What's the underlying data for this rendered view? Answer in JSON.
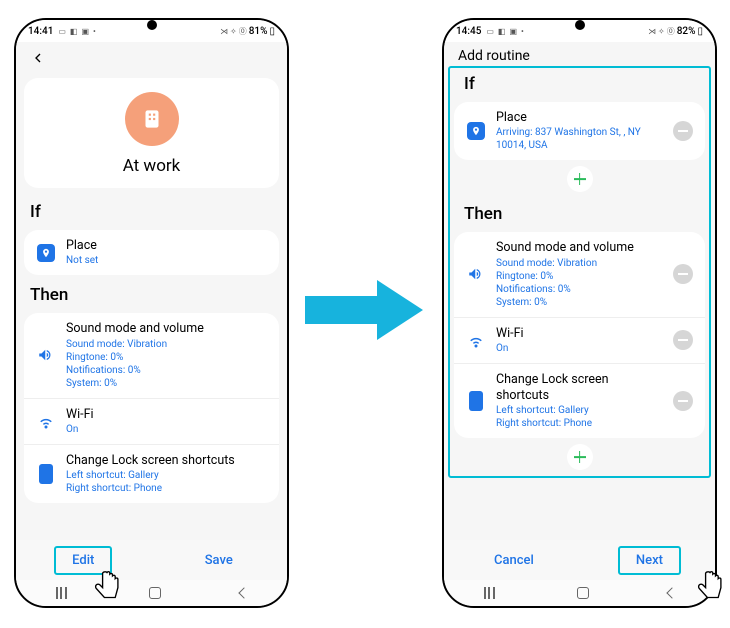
{
  "left": {
    "status": {
      "time": "14:41",
      "battery": "81%"
    },
    "title": "At work",
    "if_label": "If",
    "then_label": "Then",
    "place": {
      "title": "Place",
      "sub": "Not set"
    },
    "sound": {
      "title": "Sound mode and volume",
      "l1": "Sound mode: Vibration",
      "l2": "Ringtone: 0%",
      "l3": "Notifications: 0%",
      "l4": "System: 0%"
    },
    "wifi": {
      "title": "Wi-Fi",
      "sub": "On"
    },
    "lock": {
      "title": "Change Lock screen shortcuts",
      "l1": "Left shortcut: Gallery",
      "l2": "Right shortcut: Phone"
    },
    "footer": {
      "edit": "Edit",
      "save": "Save"
    }
  },
  "right": {
    "status": {
      "time": "14:45",
      "battery": "82%"
    },
    "header": "Add routine",
    "if_label": "If",
    "then_label": "Then",
    "place": {
      "title": "Place",
      "sub": "Arriving: 837 Washington St, , NY 10014, USA"
    },
    "sound": {
      "title": "Sound mode and volume",
      "l1": "Sound mode: Vibration",
      "l2": "Ringtone: 0%",
      "l3": "Notifications: 0%",
      "l4": "System: 0%"
    },
    "wifi": {
      "title": "Wi-Fi",
      "sub": "On"
    },
    "lock": {
      "title": "Change Lock screen shortcuts",
      "l1": "Left shortcut: Gallery",
      "l2": "Right shortcut: Phone"
    },
    "footer": {
      "cancel": "Cancel",
      "next": "Next"
    }
  }
}
